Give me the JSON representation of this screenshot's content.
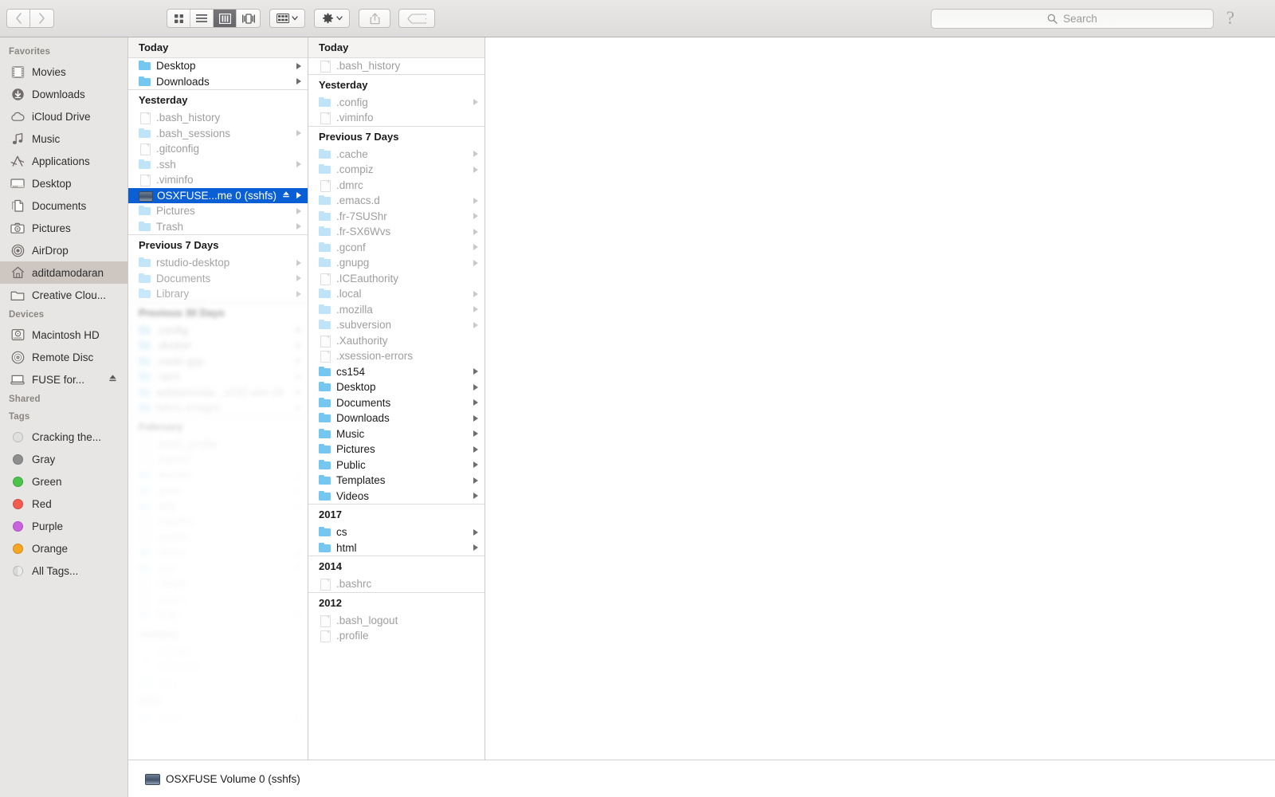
{
  "toolbar": {
    "back_label": "‹",
    "forward_label": "›",
    "view_icon_grid": "grid-view-icon",
    "view_icon_list": "list-view-icon",
    "view_icon_column": "column-view-icon",
    "view_icon_gallery": "gallery-view-icon",
    "arrange_label": "arrange-icon",
    "action_label": "gear-icon",
    "share_label": "share-icon",
    "tag_label": "tag-icon",
    "chevron": "⌄",
    "help_label": "?"
  },
  "search": {
    "placeholder": "Search",
    "icon": "search-icon",
    "value": ""
  },
  "sidebar": {
    "sections": [
      {
        "title": "Favorites",
        "items": [
          {
            "label": "Movies",
            "icon": "film-icon",
            "selected": false,
            "eject": false
          },
          {
            "label": "Downloads",
            "icon": "download-icon",
            "selected": false,
            "eject": false
          },
          {
            "label": "iCloud Drive",
            "icon": "cloud-icon",
            "selected": false,
            "eject": false
          },
          {
            "label": "Music",
            "icon": "music-note-icon",
            "selected": false,
            "eject": false
          },
          {
            "label": "Applications",
            "icon": "applications-icon",
            "selected": false,
            "eject": false
          },
          {
            "label": "Desktop",
            "icon": "desktop-icon",
            "selected": false,
            "eject": false
          },
          {
            "label": "Documents",
            "icon": "documents-icon",
            "selected": false,
            "eject": false
          },
          {
            "label": "Pictures",
            "icon": "camera-icon",
            "selected": false,
            "eject": false
          },
          {
            "label": "AirDrop",
            "icon": "airdrop-icon",
            "selected": false,
            "eject": false
          },
          {
            "label": "aditdamodaran",
            "icon": "home-icon",
            "selected": true,
            "eject": false
          },
          {
            "label": "Creative Clou...",
            "icon": "folder-icon",
            "selected": false,
            "eject": false
          }
        ]
      },
      {
        "title": "Devices",
        "items": [
          {
            "label": "Macintosh HD",
            "icon": "harddisk-icon",
            "selected": false,
            "eject": false
          },
          {
            "label": "Remote Disc",
            "icon": "optical-disc-icon",
            "selected": false,
            "eject": false
          },
          {
            "label": "FUSE for...",
            "icon": "external-drive-icon",
            "selected": false,
            "eject": true
          }
        ]
      },
      {
        "title": "Shared",
        "items": []
      },
      {
        "title": "Tags",
        "items": [
          {
            "label": "Cracking the...",
            "icon": "tag-dot",
            "color": "#e0e0e0",
            "selected": false
          },
          {
            "label": "Gray",
            "icon": "tag-dot",
            "color": "#8e8e8e",
            "selected": false
          },
          {
            "label": "Green",
            "icon": "tag-dot",
            "color": "#4cc44c",
            "selected": false
          },
          {
            "label": "Red",
            "icon": "tag-dot",
            "color": "#f35c4e",
            "selected": false
          },
          {
            "label": "Purple",
            "icon": "tag-dot",
            "color": "#c963e0",
            "selected": false
          },
          {
            "label": "Orange",
            "icon": "tag-dot",
            "color": "#f5a623",
            "selected": false
          },
          {
            "label": "All Tags...",
            "icon": "all-tags-dot",
            "color": "#d8d8d8",
            "selected": false
          }
        ]
      }
    ]
  },
  "column1": {
    "groups": [
      {
        "header": "Today",
        "header_shaded": true,
        "rows": [
          {
            "name": "Desktop",
            "icon": "folder",
            "dim": false,
            "arrow": true,
            "selected": false,
            "eject": false
          },
          {
            "name": "Downloads",
            "icon": "folder",
            "dim": false,
            "arrow": true,
            "selected": false,
            "eject": false
          }
        ]
      },
      {
        "header": "Yesterday",
        "header_shaded": false,
        "rows": [
          {
            "name": ".bash_history",
            "icon": "doc",
            "dim": true,
            "arrow": false,
            "selected": false,
            "eject": false
          },
          {
            "name": ".bash_sessions",
            "icon": "folder",
            "dim": true,
            "arrow": true,
            "selected": false,
            "eject": false
          },
          {
            "name": ".gitconfig",
            "icon": "doc",
            "dim": true,
            "arrow": false,
            "selected": false,
            "eject": false
          },
          {
            "name": ".ssh",
            "icon": "folder",
            "dim": true,
            "arrow": true,
            "selected": false,
            "eject": false
          },
          {
            "name": ".viminfo",
            "icon": "doc",
            "dim": true,
            "arrow": false,
            "selected": false,
            "eject": false
          },
          {
            "name": "OSXFUSE...me 0 (sshfs)",
            "icon": "drive",
            "dim": false,
            "arrow": true,
            "selected": true,
            "eject": true
          },
          {
            "name": "Pictures",
            "icon": "folder",
            "dim": true,
            "arrow": true,
            "selected": false,
            "eject": false
          },
          {
            "name": "Trash",
            "icon": "folder",
            "dim": true,
            "arrow": true,
            "selected": false,
            "eject": false
          }
        ]
      },
      {
        "header": "Previous 7 Days",
        "header_shaded": false,
        "rows": [
          {
            "name": "rstudio-desktop",
            "icon": "folder",
            "dim": true,
            "arrow": true,
            "selected": false,
            "eject": false
          },
          {
            "name": "Documents",
            "icon": "folder",
            "dim": true,
            "arrow": true,
            "selected": false,
            "eject": false
          },
          {
            "name": "Library",
            "icon": "folder",
            "dim": true,
            "arrow": true,
            "selected": false,
            "eject": false
          }
        ]
      },
      {
        "header": "Previous 30 Days",
        "header_shaded": false,
        "rows": [
          {
            "name": ".config",
            "icon": "folder",
            "dim": true,
            "arrow": true,
            "selected": false,
            "eject": false
          },
          {
            "name": ".docker",
            "icon": "folder",
            "dim": true,
            "arrow": true,
            "selected": false,
            "eject": false
          },
          {
            "name": ".node-gyp",
            "icon": "folder",
            "dim": true,
            "arrow": true,
            "selected": false,
            "eject": false
          },
          {
            "name": ".npm",
            "icon": "folder",
            "dim": true,
            "arrow": true,
            "selected": false,
            "eject": false
          },
          {
            "name": "aditdamodar...s152-win-18",
            "icon": "folder",
            "dim": true,
            "arrow": true,
            "selected": false,
            "eject": false
          },
          {
            "name": "fabric-images",
            "icon": "folder",
            "dim": true,
            "arrow": true,
            "selected": false,
            "eject": false
          }
        ]
      },
      {
        "header": "February",
        "header_shaded": false,
        "rows": [
          {
            "name": ".bash_profile",
            "icon": "doc",
            "dim": true,
            "arrow": false,
            "selected": false,
            "eject": false
          },
          {
            "name": ".bashrc",
            "icon": "doc",
            "dim": true,
            "arrow": false,
            "selected": false,
            "eject": false
          },
          {
            "name": ".bundle",
            "icon": "folder",
            "dim": true,
            "arrow": true,
            "selected": false,
            "eject": false
          },
          {
            "name": ".gem",
            "icon": "folder",
            "dim": true,
            "arrow": true,
            "selected": false,
            "eject": false
          },
          {
            "name": ".lldb",
            "icon": "folder",
            "dim": true,
            "arrow": true,
            "selected": false,
            "eject": false
          },
          {
            "name": ".mkshrc",
            "icon": "doc",
            "dim": true,
            "arrow": false,
            "selected": false,
            "eject": false
          },
          {
            "name": ".profile",
            "icon": "doc",
            "dim": true,
            "arrow": false,
            "selected": false,
            "eject": false
          },
          {
            "name": ".rbenv",
            "icon": "folder",
            "dim": true,
            "arrow": true,
            "selected": false,
            "eject": false
          },
          {
            "name": ".rvm",
            "icon": "folder",
            "dim": true,
            "arrow": true,
            "selected": false,
            "eject": false
          },
          {
            "name": ".zlogin",
            "icon": "doc",
            "dim": true,
            "arrow": false,
            "selected": false,
            "eject": false
          },
          {
            "name": ".zshrc",
            "icon": "doc",
            "dim": true,
            "arrow": false,
            "selected": false,
            "eject": false
          },
          {
            "name": "Ruby",
            "icon": "folder",
            "dim": true,
            "arrow": true,
            "selected": false,
            "eject": false
          }
        ]
      },
      {
        "header": "January",
        "header_shaded": false,
        "rows": [
          {
            "name": ".RData",
            "icon": "doc",
            "dim": true,
            "arrow": false,
            "selected": false,
            "eject": false
          },
          {
            "name": ".Rhistory",
            "icon": "doc",
            "dim": true,
            "arrow": false,
            "selected": false,
            "eject": false
          },
          {
            "name": ".vim",
            "icon": "folder",
            "dim": true,
            "arrow": true,
            "selected": false,
            "eject": false
          }
        ]
      },
      {
        "header": "2017",
        "header_shaded": false,
        "rows": [
          {
            "name": ".atom",
            "icon": "folder",
            "dim": true,
            "arrow": true,
            "selected": false,
            "eject": false
          }
        ]
      }
    ]
  },
  "column2": {
    "groups": [
      {
        "header": "Today",
        "header_shaded": true,
        "rows": [
          {
            "name": ".bash_history",
            "icon": "doc",
            "dim": true,
            "arrow": false
          }
        ]
      },
      {
        "header": "Yesterday",
        "header_shaded": false,
        "rows": [
          {
            "name": ".config",
            "icon": "folder",
            "dim": true,
            "arrow": true
          },
          {
            "name": ".viminfo",
            "icon": "doc",
            "dim": true,
            "arrow": false
          }
        ]
      },
      {
        "header": "Previous 7 Days",
        "header_shaded": false,
        "rows": [
          {
            "name": ".cache",
            "icon": "folder",
            "dim": true,
            "arrow": true
          },
          {
            "name": ".compiz",
            "icon": "folder",
            "dim": true,
            "arrow": true
          },
          {
            "name": ".dmrc",
            "icon": "doc",
            "dim": true,
            "arrow": false
          },
          {
            "name": ".emacs.d",
            "icon": "folder",
            "dim": true,
            "arrow": true
          },
          {
            "name": ".fr-7SUShr",
            "icon": "folder",
            "dim": true,
            "arrow": true
          },
          {
            "name": ".fr-SX6Wvs",
            "icon": "folder",
            "dim": true,
            "arrow": true
          },
          {
            "name": ".gconf",
            "icon": "folder",
            "dim": true,
            "arrow": true
          },
          {
            "name": ".gnupg",
            "icon": "folder",
            "dim": true,
            "arrow": true
          },
          {
            "name": ".ICEauthority",
            "icon": "doc",
            "dim": true,
            "arrow": false
          },
          {
            "name": ".local",
            "icon": "folder",
            "dim": true,
            "arrow": true
          },
          {
            "name": ".mozilla",
            "icon": "folder",
            "dim": true,
            "arrow": true
          },
          {
            "name": ".subversion",
            "icon": "folder",
            "dim": true,
            "arrow": true
          },
          {
            "name": ".Xauthority",
            "icon": "doc",
            "dim": true,
            "arrow": false
          },
          {
            "name": ".xsession-errors",
            "icon": "doc",
            "dim": true,
            "arrow": false
          },
          {
            "name": "cs154",
            "icon": "folder",
            "dim": false,
            "arrow": true
          },
          {
            "name": "Desktop",
            "icon": "folder",
            "dim": false,
            "arrow": true
          },
          {
            "name": "Documents",
            "icon": "folder",
            "dim": false,
            "arrow": true
          },
          {
            "name": "Downloads",
            "icon": "folder",
            "dim": false,
            "arrow": true
          },
          {
            "name": "Music",
            "icon": "folder",
            "dim": false,
            "arrow": true
          },
          {
            "name": "Pictures",
            "icon": "folder",
            "dim": false,
            "arrow": true
          },
          {
            "name": "Public",
            "icon": "folder",
            "dim": false,
            "arrow": true
          },
          {
            "name": "Templates",
            "icon": "folder",
            "dim": false,
            "arrow": true
          },
          {
            "name": "Videos",
            "icon": "folder",
            "dim": false,
            "arrow": true
          }
        ]
      },
      {
        "header": "2017",
        "header_shaded": false,
        "rows": [
          {
            "name": "cs",
            "icon": "folder",
            "dim": false,
            "arrow": true
          },
          {
            "name": "html",
            "icon": "folder",
            "dim": false,
            "arrow": true
          }
        ]
      },
      {
        "header": "2014",
        "header_shaded": false,
        "rows": [
          {
            "name": ".bashrc",
            "icon": "doc",
            "dim": true,
            "arrow": false
          }
        ]
      },
      {
        "header": "2012",
        "header_shaded": false,
        "rows": [
          {
            "name": ".bash_logout",
            "icon": "doc",
            "dim": true,
            "arrow": false
          },
          {
            "name": ".profile",
            "icon": "doc",
            "dim": true,
            "arrow": false
          }
        ]
      }
    ]
  },
  "statusbar": {
    "label": "OSXFUSE Volume 0 (sshfs)",
    "icon": "fuse-drive-icon"
  }
}
